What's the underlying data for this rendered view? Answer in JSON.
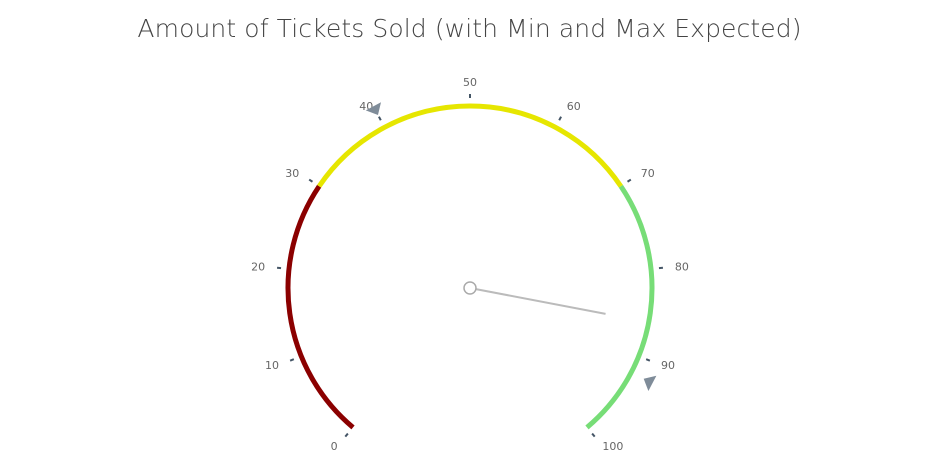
{
  "chart_data": {
    "type": "gauge",
    "title": "Amount of Tickets Sold (with Min and Max Expected)",
    "min": 0,
    "max": 100,
    "value": 86,
    "tick_values": [
      0,
      10,
      20,
      30,
      40,
      50,
      60,
      70,
      80,
      90,
      100
    ],
    "bands": [
      {
        "from": 0,
        "to": 30,
        "color": "#8b0000"
      },
      {
        "from": 30,
        "to": 70,
        "color": "#e6e600"
      },
      {
        "from": 70,
        "to": 100,
        "color": "#77dd77"
      }
    ],
    "markers": [
      {
        "name": "min-expected",
        "value": 40,
        "color": "#7f8c99"
      },
      {
        "name": "max-expected",
        "value": 92,
        "color": "#7f8c99"
      }
    ],
    "needle_color": "#bbbbbb"
  }
}
